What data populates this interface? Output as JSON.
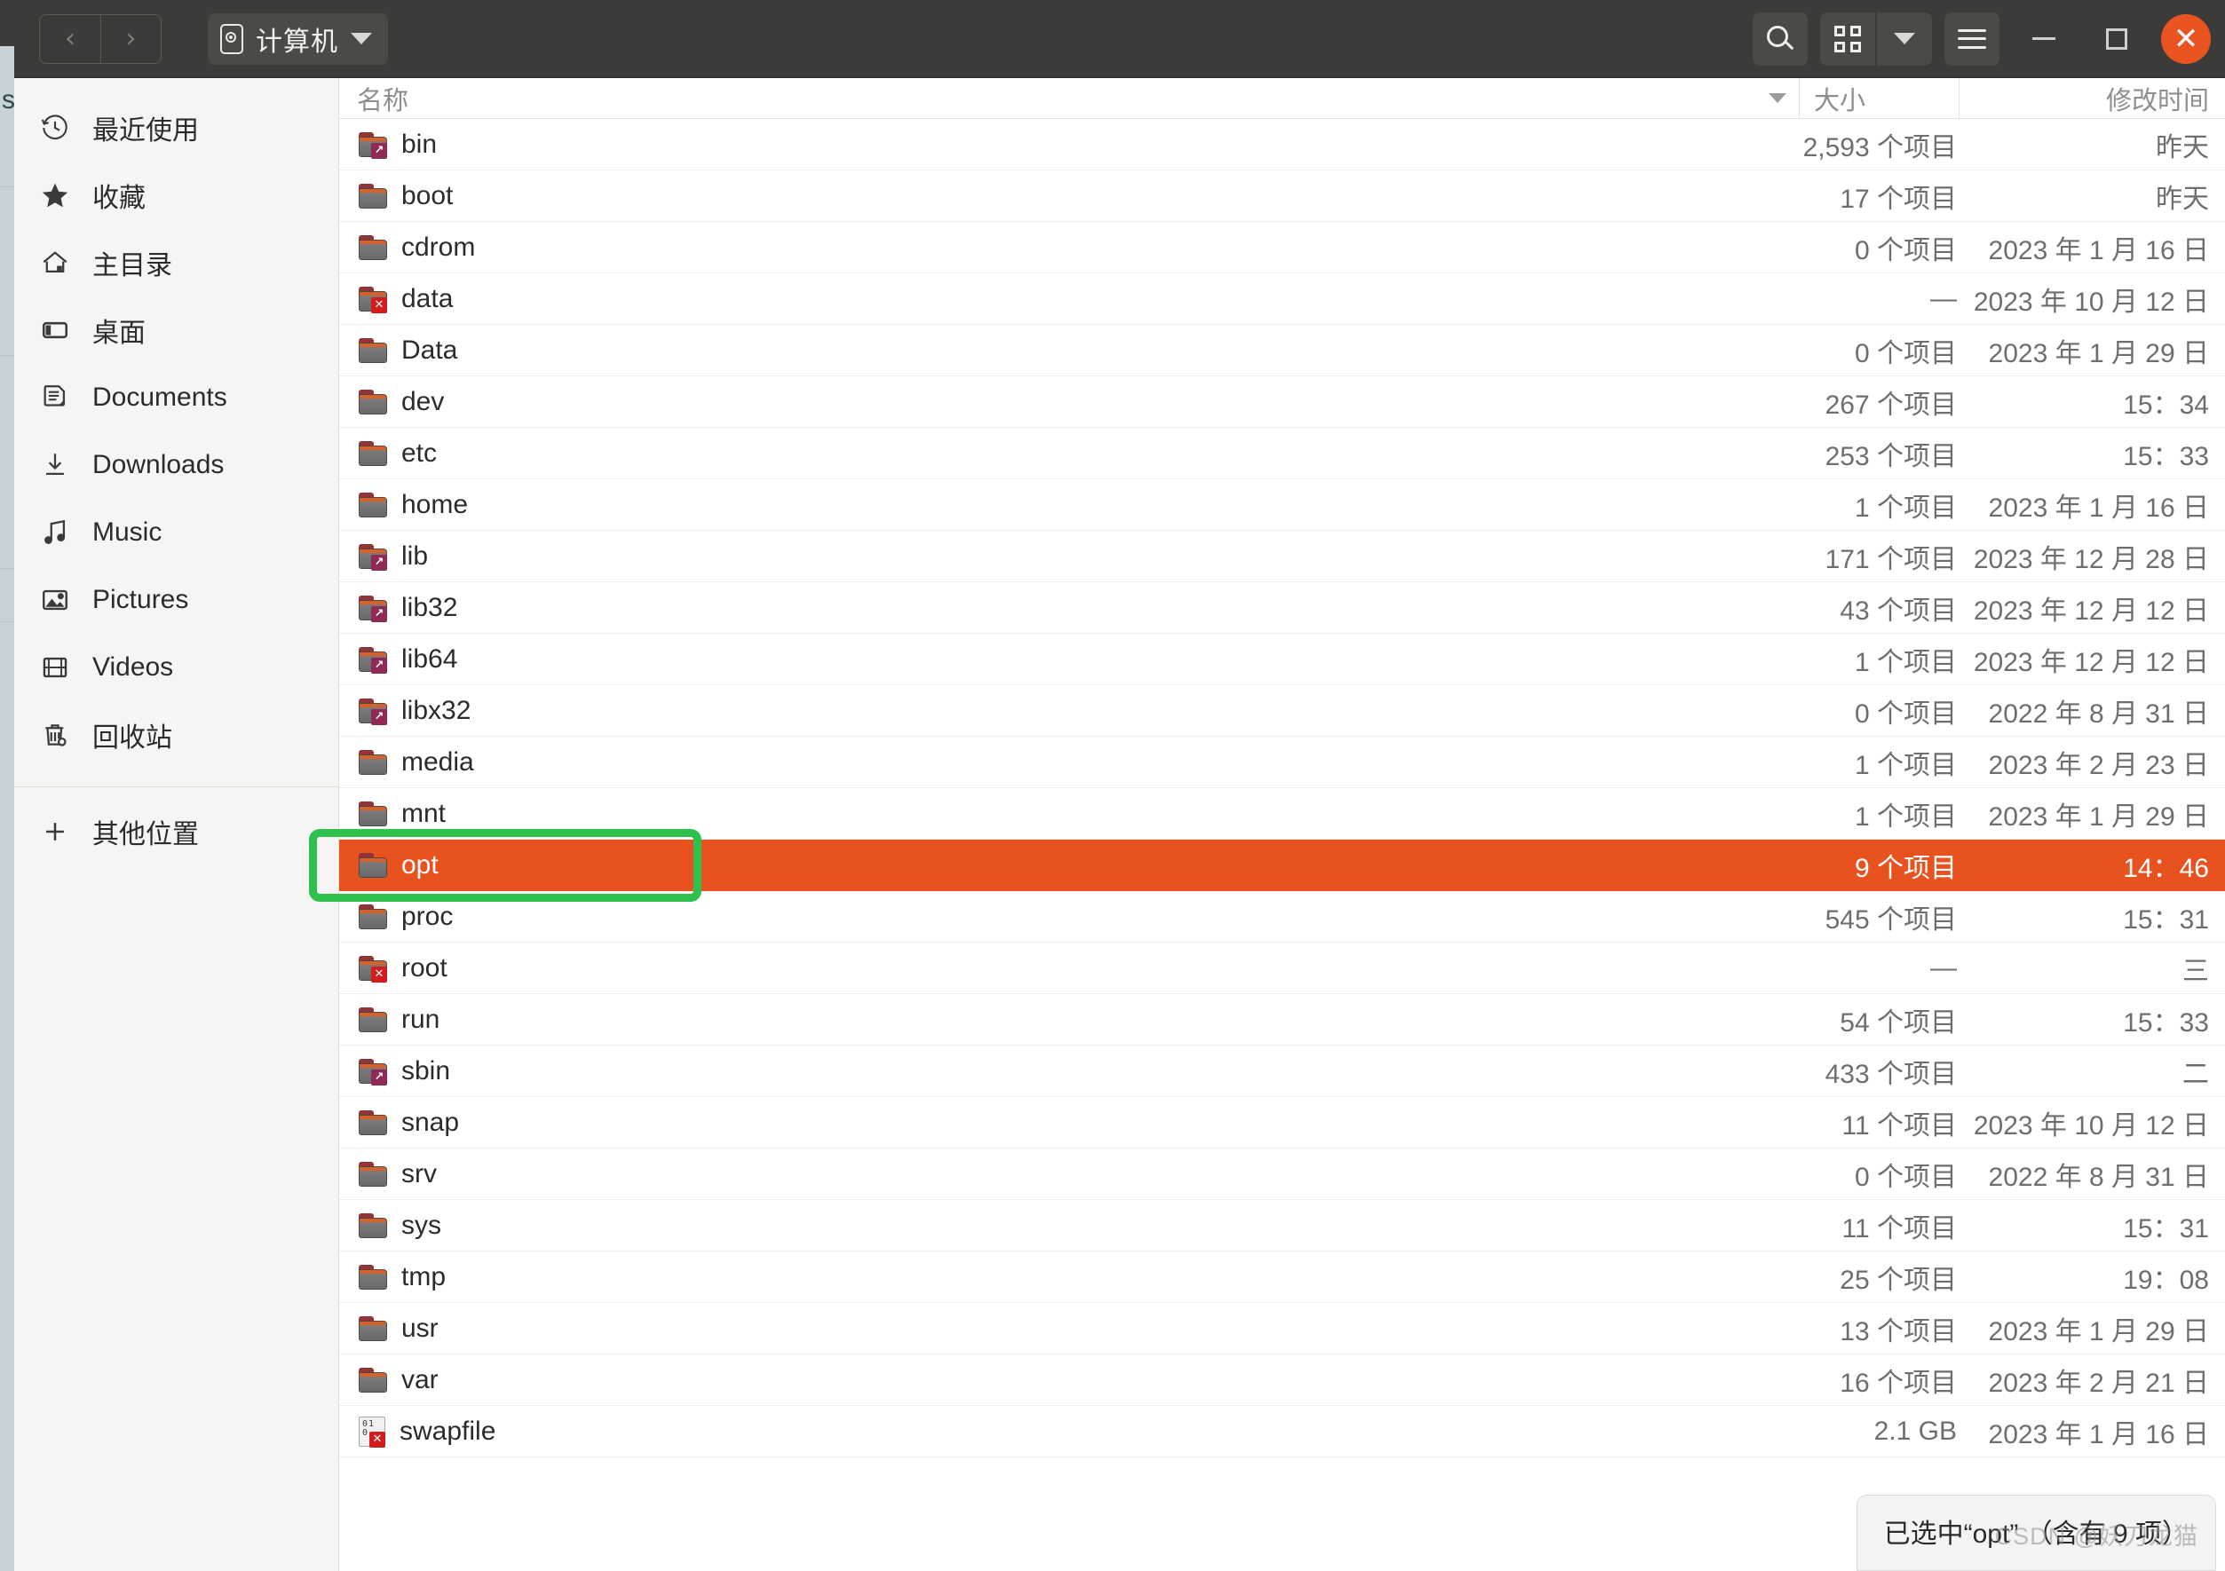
{
  "window": {
    "title": "计算机",
    "path_icon": "disk-icon"
  },
  "headerbar": {
    "back_label": "‹",
    "forward_label": "›",
    "search_icon": "search-icon",
    "view_grid_icon": "grid-view-icon",
    "view_dropdown_icon": "chevron-down-icon",
    "menu_icon": "hamburger-menu-icon",
    "minimize_label": "",
    "maximize_label": "",
    "close_label": "✕"
  },
  "sidebar": {
    "items": [
      {
        "label": "最近使用",
        "icon": "clock-history-icon"
      },
      {
        "label": "收藏",
        "icon": "star-icon"
      },
      {
        "label": "主目录",
        "icon": "home-icon"
      },
      {
        "label": "桌面",
        "icon": "desktop-icon"
      },
      {
        "label": "Documents",
        "icon": "document-icon"
      },
      {
        "label": "Downloads",
        "icon": "download-icon"
      },
      {
        "label": "Music",
        "icon": "music-note-icon"
      },
      {
        "label": "Pictures",
        "icon": "image-icon"
      },
      {
        "label": "Videos",
        "icon": "film-icon"
      },
      {
        "label": "回收站",
        "icon": "trash-icon"
      }
    ],
    "other_locations": {
      "label": "其他位置",
      "icon": "plus-icon"
    }
  },
  "columns": {
    "name": "名称",
    "size": "大小",
    "modified": "修改时间",
    "sort_icon": "sort-descending-caret"
  },
  "files": [
    {
      "name": "bin",
      "icon": "folder-symlink",
      "size": "2,593 个项目",
      "modified": "昨天",
      "selected": false
    },
    {
      "name": "boot",
      "icon": "folder",
      "size": "17 个项目",
      "modified": "昨天",
      "selected": false
    },
    {
      "name": "cdrom",
      "icon": "folder",
      "size": "0 个项目",
      "modified": "2023 年 1 月 16 日",
      "selected": false
    },
    {
      "name": "data",
      "icon": "folder-locked",
      "size": "—",
      "modified": "2023 年 10 月 12 日",
      "selected": false
    },
    {
      "name": "Data",
      "icon": "folder",
      "size": "0 个项目",
      "modified": "2023 年 1 月 29 日",
      "selected": false
    },
    {
      "name": "dev",
      "icon": "folder",
      "size": "267 个项目",
      "modified": "15：34",
      "selected": false
    },
    {
      "name": "etc",
      "icon": "folder",
      "size": "253 个项目",
      "modified": "15：33",
      "selected": false
    },
    {
      "name": "home",
      "icon": "folder",
      "size": "1 个项目",
      "modified": "2023 年 1 月 16 日",
      "selected": false
    },
    {
      "name": "lib",
      "icon": "folder-symlink",
      "size": "171 个项目",
      "modified": "2023 年 12 月 28 日",
      "selected": false
    },
    {
      "name": "lib32",
      "icon": "folder-symlink",
      "size": "43 个项目",
      "modified": "2023 年 12 月 12 日",
      "selected": false
    },
    {
      "name": "lib64",
      "icon": "folder-symlink",
      "size": "1 个项目",
      "modified": "2023 年 12 月 12 日",
      "selected": false
    },
    {
      "name": "libx32",
      "icon": "folder-symlink",
      "size": "0 个项目",
      "modified": "2022 年 8 月 31 日",
      "selected": false
    },
    {
      "name": "media",
      "icon": "folder",
      "size": "1 个项目",
      "modified": "2023 年 2 月 23 日",
      "selected": false
    },
    {
      "name": "mnt",
      "icon": "folder",
      "size": "1 个项目",
      "modified": "2023 年 1 月 29 日",
      "selected": false
    },
    {
      "name": "opt",
      "icon": "folder",
      "size": "9 个项目",
      "modified": "14：46",
      "selected": true
    },
    {
      "name": "proc",
      "icon": "folder",
      "size": "545 个项目",
      "modified": "15：31",
      "selected": false
    },
    {
      "name": "root",
      "icon": "folder-locked",
      "size": "—",
      "modified": "三",
      "selected": false
    },
    {
      "name": "run",
      "icon": "folder",
      "size": "54 个项目",
      "modified": "15：33",
      "selected": false
    },
    {
      "name": "sbin",
      "icon": "folder-symlink",
      "size": "433 个项目",
      "modified": "二",
      "selected": false
    },
    {
      "name": "snap",
      "icon": "folder",
      "size": "11 个项目",
      "modified": "2023 年 10 月 12 日",
      "selected": false
    },
    {
      "name": "srv",
      "icon": "folder",
      "size": "0 个项目",
      "modified": "2022 年 8 月 31 日",
      "selected": false
    },
    {
      "name": "sys",
      "icon": "folder",
      "size": "11 个项目",
      "modified": "15：31",
      "selected": false
    },
    {
      "name": "tmp",
      "icon": "folder",
      "size": "25 个项目",
      "modified": "19：08",
      "selected": false
    },
    {
      "name": "usr",
      "icon": "folder",
      "size": "13 个项目",
      "modified": "2023 年 1 月 29 日",
      "selected": false
    },
    {
      "name": "var",
      "icon": "folder",
      "size": "16 个项目",
      "modified": "2023 年 2 月 21 日",
      "selected": false
    },
    {
      "name": "swapfile",
      "icon": "binary-locked",
      "size": "2.1 GB",
      "modified": "2023 年 1 月 16 日",
      "selected": false
    }
  ],
  "statusbar": {
    "text": "已选中“opt” （含有 9 项）"
  },
  "watermark": {
    "text": "CSDN @妖刀龙猫"
  },
  "annotation": {
    "color": "#2fc14e",
    "target": "opt"
  },
  "colors": {
    "selection": "#e8521f",
    "close_button": "#e95420",
    "headerbar": "#3b3b39",
    "sidebar": "#f6f5f4"
  }
}
